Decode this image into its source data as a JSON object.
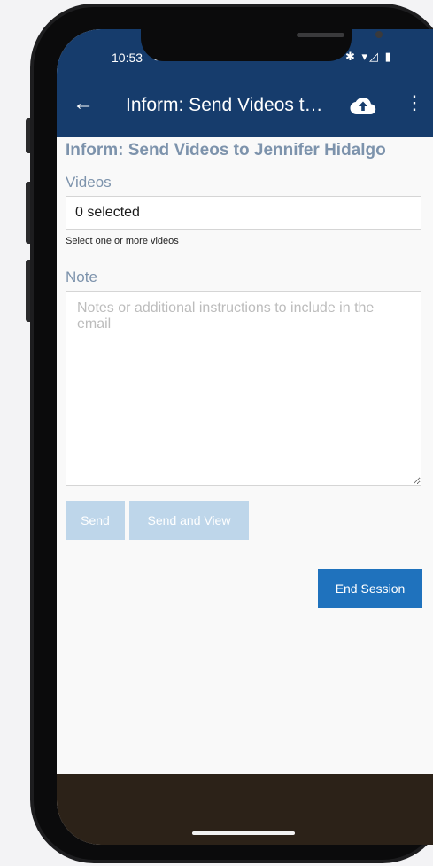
{
  "status_bar": {
    "time": "10:53",
    "left_icons": "⊙ ▭ ▭",
    "right_icons": "✱ ▾◿ ▮"
  },
  "app_bar": {
    "back_icon": "back-arrow-icon",
    "title": "Inform: Send Videos t…",
    "upload_icon": "cloud-upload-icon",
    "menu_icon": "more-vert-icon"
  },
  "form": {
    "title": "Inform: Send Videos to Jennifer Hidalgo",
    "videos_label": "Videos",
    "videos_value": "0 selected",
    "videos_hint": "Select one or more videos",
    "note_label": "Note",
    "note_placeholder": "Notes or additional instructions to include in the email",
    "note_value": ""
  },
  "buttons": {
    "send": "Send",
    "send_and_view": "Send and View",
    "end_session": "End Session"
  },
  "colors": {
    "app_bar": "#163c6c",
    "label": "#7d93ac",
    "disabled_button": "#bed6ea",
    "primary_button": "#1f72bd",
    "nav_bar": "#2c2218"
  }
}
